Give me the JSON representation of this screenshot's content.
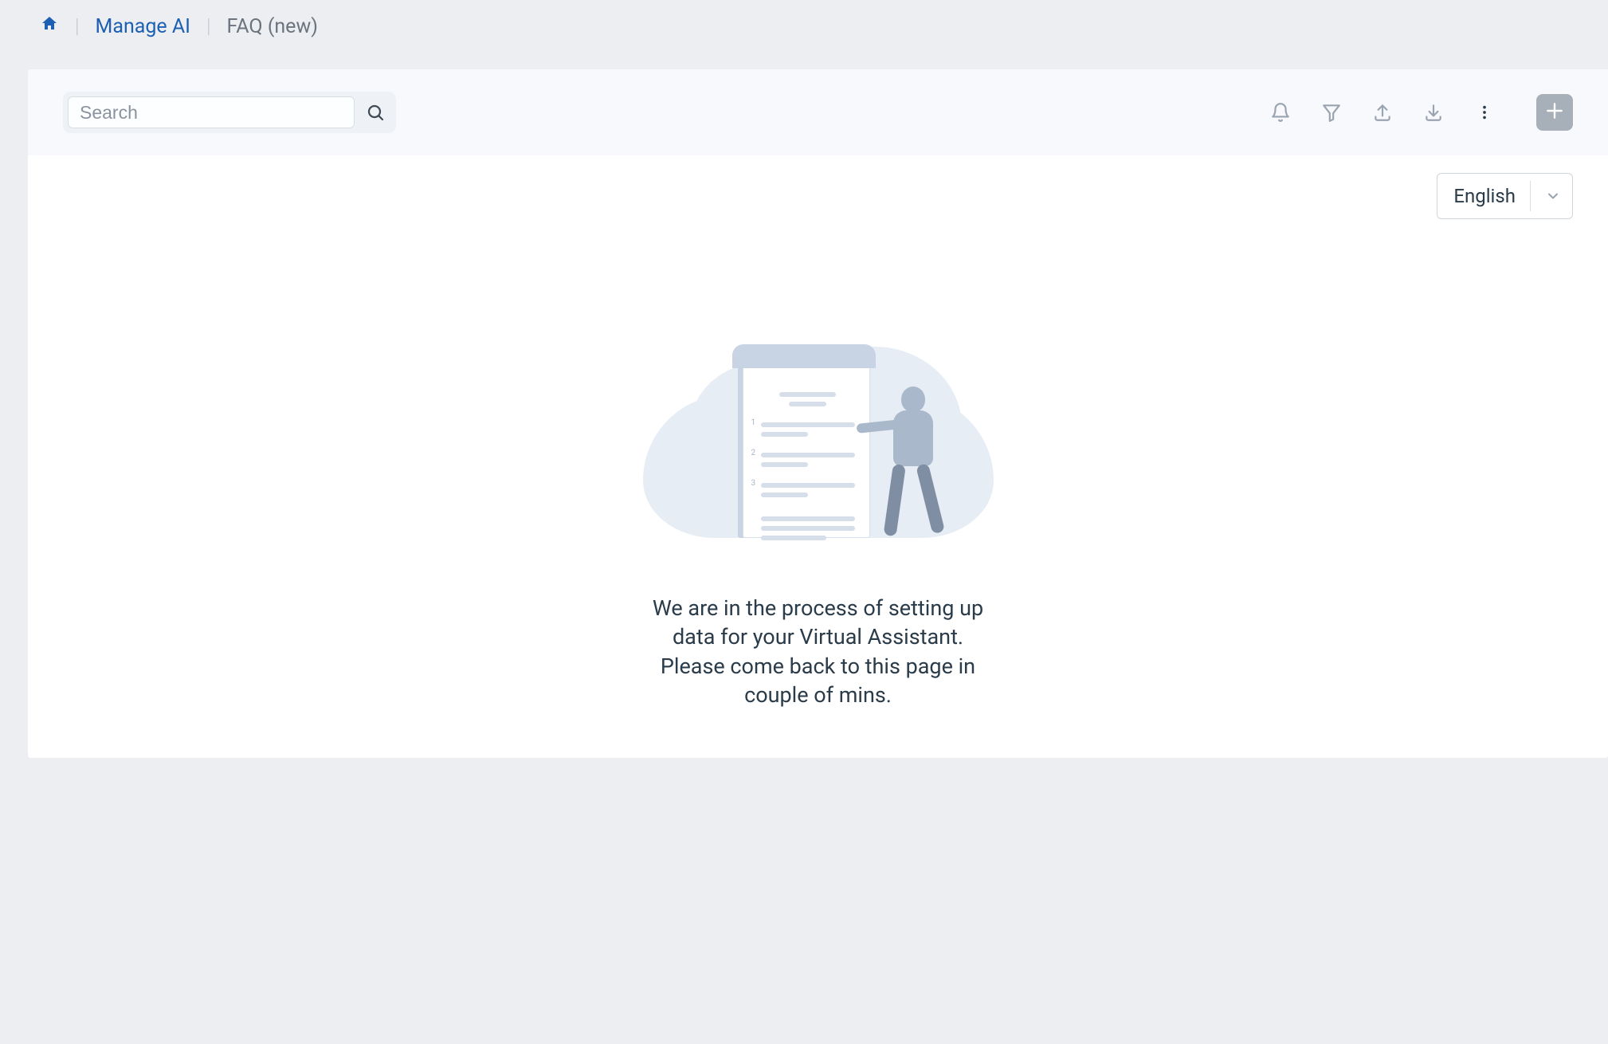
{
  "breadcrumb": {
    "manage_ai": "Manage AI",
    "current": "FAQ (new)"
  },
  "toolbar": {
    "search_placeholder": "Search",
    "icons": {
      "bell": "notifications-icon",
      "filter": "filter-icon",
      "upload": "upload-icon",
      "download": "download-icon",
      "more": "more-vertical-icon",
      "add": "plus-icon"
    }
  },
  "language": {
    "selected": "English"
  },
  "empty_state": {
    "message": "We are in the process of setting up\ndata for your Virtual Assistant.\nPlease come back to this page in\ncouple of mins."
  }
}
